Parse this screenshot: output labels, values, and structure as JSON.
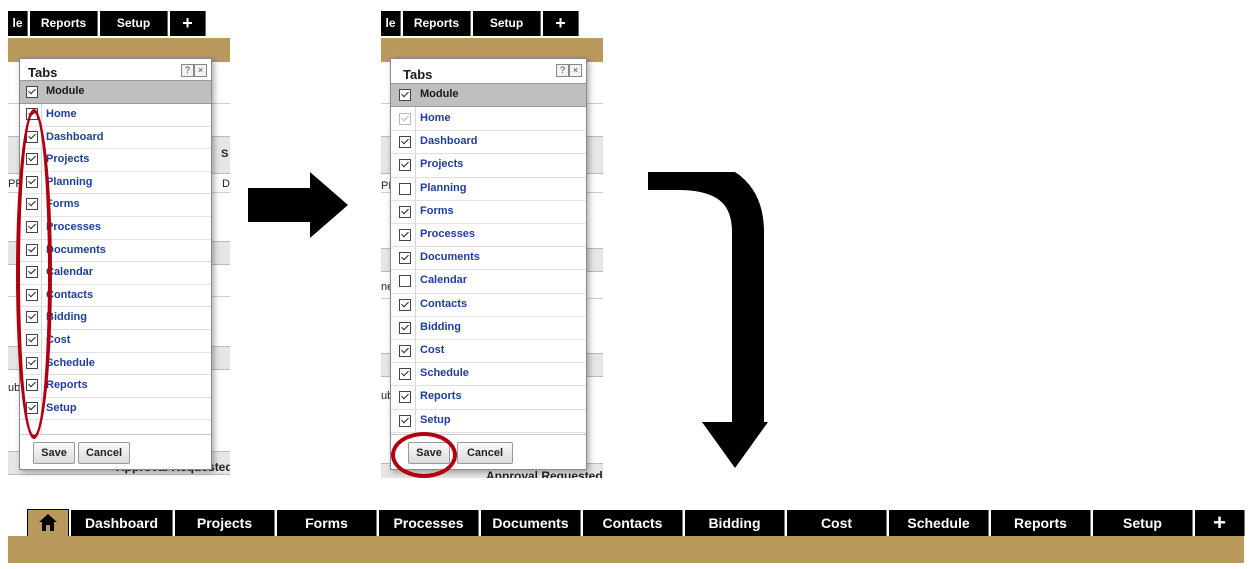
{
  "top_tabs": [
    "le",
    "Reports",
    "Setup",
    "+"
  ],
  "dialog": {
    "title": "Tabs",
    "help_icon": "?",
    "close_icon": "×",
    "column_header": "Module",
    "save_label": "Save",
    "cancel_label": "Cancel"
  },
  "dialog_before": {
    "items": [
      {
        "label": "Home",
        "checked": true
      },
      {
        "label": "Dashboard",
        "checked": true
      },
      {
        "label": "Projects",
        "checked": true
      },
      {
        "label": "Planning",
        "checked": true
      },
      {
        "label": "Forms",
        "checked": true
      },
      {
        "label": "Processes",
        "checked": true
      },
      {
        "label": "Documents",
        "checked": true
      },
      {
        "label": "Calendar",
        "checked": true
      },
      {
        "label": "Contacts",
        "checked": true
      },
      {
        "label": "Bidding",
        "checked": true
      },
      {
        "label": "Cost",
        "checked": true
      },
      {
        "label": "Schedule",
        "checked": true
      },
      {
        "label": "Reports",
        "checked": true
      },
      {
        "label": "Setup",
        "checked": true
      }
    ]
  },
  "dialog_after": {
    "items": [
      {
        "label": "Home",
        "checked": true,
        "disabled": true
      },
      {
        "label": "Dashboard",
        "checked": true
      },
      {
        "label": "Projects",
        "checked": true
      },
      {
        "label": "Planning",
        "checked": false
      },
      {
        "label": "Forms",
        "checked": true
      },
      {
        "label": "Processes",
        "checked": true
      },
      {
        "label": "Documents",
        "checked": true
      },
      {
        "label": "Calendar",
        "checked": false
      },
      {
        "label": "Contacts",
        "checked": true
      },
      {
        "label": "Bidding",
        "checked": true
      },
      {
        "label": "Cost",
        "checked": true
      },
      {
        "label": "Schedule",
        "checked": true
      },
      {
        "label": "Reports",
        "checked": true
      },
      {
        "label": "Setup",
        "checked": true
      }
    ]
  },
  "background": {
    "col_s": "S",
    "cell_d": "D",
    "cell_pr": "PF",
    "row_ner": "ner",
    "row_ub": "ub",
    "approval_text": "Approval Requested By"
  },
  "final_nav": {
    "home_icon": "home-icon",
    "tabs": [
      "Dashboard",
      "Projects",
      "Forms",
      "Processes",
      "Documents",
      "Contacts",
      "Bidding",
      "Cost",
      "Schedule",
      "Reports",
      "Setup",
      "+"
    ]
  },
  "colors": {
    "nav_tan": "#b99a5c",
    "annotation_red": "#b00010",
    "link_blue": "#1f3e99"
  }
}
